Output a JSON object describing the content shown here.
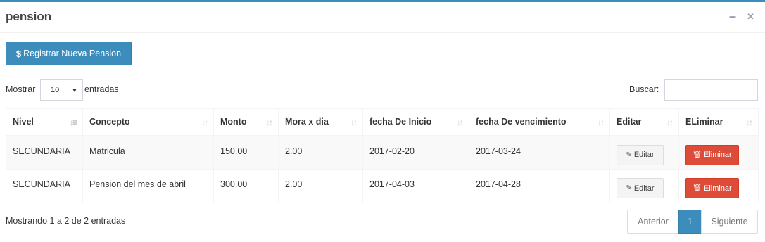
{
  "box": {
    "title": "pension",
    "minimize_icon": "minus-icon",
    "close_icon": "times-icon"
  },
  "toolbar": {
    "register_icon": "$",
    "register_label": "Registrar Nueva Pension"
  },
  "length_menu": {
    "prefix": "Mostrar",
    "value": "10",
    "suffix": "entradas"
  },
  "search": {
    "label": "Buscar:",
    "value": ""
  },
  "table": {
    "headers": [
      "Nivel",
      "Concepto",
      "Monto",
      "Mora x dia",
      "fecha De Inicio",
      "fecha De vencimiento",
      "Editar",
      "ELiminar"
    ],
    "rows": [
      {
        "nivel": "SECUNDARIA",
        "concepto": "Matricula",
        "monto": "150.00",
        "mora": "2.00",
        "inicio": "2017-02-20",
        "vencimiento": "2017-03-24",
        "edit_label": "Editar",
        "delete_label": "Eliminar"
      },
      {
        "nivel": "SECUNDARIA",
        "concepto": "Pension del mes de abril",
        "monto": "300.00",
        "mora": "2.00",
        "inicio": "2017-04-03",
        "vencimiento": "2017-04-28",
        "edit_label": "Editar",
        "delete_label": "Eliminar"
      }
    ]
  },
  "footer": {
    "info": "Mostrando 1 a 2 de 2 entradas",
    "prev": "Anterior",
    "current_page": "1",
    "next": "Siguiente"
  },
  "colors": {
    "primary": "#3c8dbc",
    "danger": "#dd4b39"
  }
}
